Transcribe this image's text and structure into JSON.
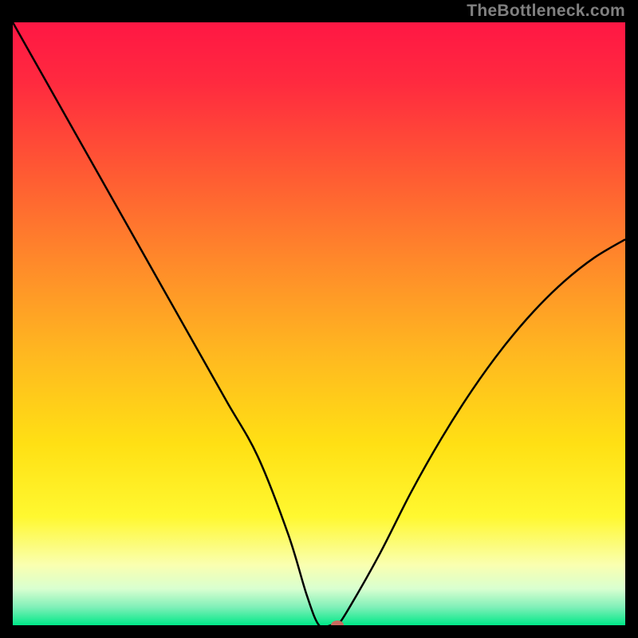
{
  "site_label": "TheBottleneck.com",
  "chart_data": {
    "type": "line",
    "title": "",
    "xlabel": "",
    "ylabel": "",
    "xlim": [
      0,
      100
    ],
    "ylim": [
      0,
      100
    ],
    "curve": {
      "name": "bottleneck",
      "x": [
        0,
        5,
        10,
        15,
        20,
        25,
        30,
        35,
        40,
        45,
        48,
        50,
        52,
        53,
        55,
        60,
        65,
        70,
        75,
        80,
        85,
        90,
        95,
        100
      ],
      "y": [
        100,
        91,
        82,
        73,
        64,
        55,
        46,
        37,
        28,
        15,
        5,
        0,
        0,
        0,
        3,
        12,
        22,
        31,
        39,
        46,
        52,
        57,
        61,
        64
      ]
    },
    "marker": {
      "x": 53,
      "y": 0,
      "color": "#c96a5f"
    },
    "background_gradient": {
      "stops": [
        {
          "offset": 0.0,
          "color": "#ff1744"
        },
        {
          "offset": 0.1,
          "color": "#ff2a3f"
        },
        {
          "offset": 0.25,
          "color": "#ff5a33"
        },
        {
          "offset": 0.4,
          "color": "#ff8a2a"
        },
        {
          "offset": 0.55,
          "color": "#ffb820"
        },
        {
          "offset": 0.7,
          "color": "#ffe014"
        },
        {
          "offset": 0.82,
          "color": "#fff830"
        },
        {
          "offset": 0.9,
          "color": "#faffb0"
        },
        {
          "offset": 0.94,
          "color": "#d8ffd0"
        },
        {
          "offset": 0.97,
          "color": "#80f0b8"
        },
        {
          "offset": 1.0,
          "color": "#00e888"
        }
      ]
    }
  }
}
